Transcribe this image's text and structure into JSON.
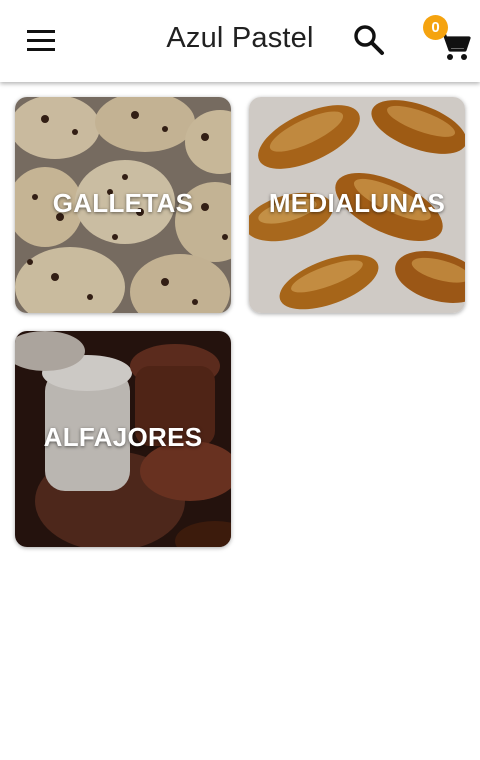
{
  "app_bar": {
    "title": "Azul Pastel",
    "menu_icon": "menu-icon",
    "search_icon": "search-icon",
    "cart_icon": "shopping-cart-icon",
    "cart_count": "0",
    "badge_color": "#f5a30f"
  },
  "categories": [
    {
      "label": "GALLETAS",
      "image": "chocolate-chip-cookies"
    },
    {
      "label": "MEDIALUNAS",
      "image": "croissants"
    },
    {
      "label": "ALFAJORES",
      "image": "chocolate-alfajores"
    }
  ]
}
